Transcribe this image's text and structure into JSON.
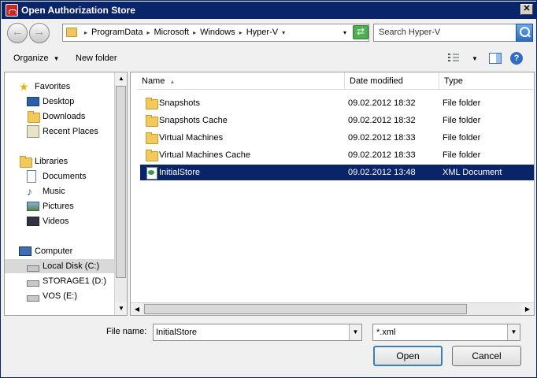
{
  "window": {
    "title": "Open Authorization Store",
    "close_glyph": "✕"
  },
  "nav": {
    "back_glyph": "←",
    "forward_glyph": "→"
  },
  "address": {
    "crumbs": [
      "ProgramData",
      "Microsoft",
      "Windows",
      "Hyper-V"
    ],
    "separator_glyph": "▸",
    "dropdown_glyph": "▾",
    "refresh_glyph": "⇄"
  },
  "search": {
    "placeholder": "Search Hyper-V"
  },
  "toolbar": {
    "organize_label": "Organize",
    "organize_caret": "▼",
    "new_folder_label": "New folder",
    "views_caret": "▼",
    "help_glyph": "?"
  },
  "sidebar": {
    "groups": [
      {
        "label": "Favorites",
        "icon": "star-icon",
        "items": [
          {
            "label": "Desktop",
            "icon": "desktop-icon"
          },
          {
            "label": "Downloads",
            "icon": "downloads-icon"
          },
          {
            "label": "Recent Places",
            "icon": "recent-places-icon"
          }
        ]
      },
      {
        "label": "Libraries",
        "icon": "libraries-icon",
        "items": [
          {
            "label": "Documents",
            "icon": "documents-icon"
          },
          {
            "label": "Music",
            "icon": "music-icon"
          },
          {
            "label": "Pictures",
            "icon": "pictures-icon"
          },
          {
            "label": "Videos",
            "icon": "videos-icon"
          }
        ]
      },
      {
        "label": "Computer",
        "icon": "computer-icon",
        "items": [
          {
            "label": "Local Disk (C:)",
            "icon": "local-disk-icon",
            "selected": true
          },
          {
            "label": "STORAGE1 (D:)",
            "icon": "drive-icon"
          },
          {
            "label": "VOS (E:)",
            "icon": "drive-icon"
          }
        ]
      }
    ]
  },
  "file_list": {
    "columns": [
      "Name",
      "Date modified",
      "Type"
    ],
    "sort_glyph": "▲",
    "rows": [
      {
        "name": "Snapshots",
        "date": "09.02.2012 18:32",
        "type": "File folder",
        "icon": "folder-icon"
      },
      {
        "name": "Snapshots Cache",
        "date": "09.02.2012 18:32",
        "type": "File folder",
        "icon": "folder-icon"
      },
      {
        "name": "Virtual Machines",
        "date": "09.02.2012 18:33",
        "type": "File folder",
        "icon": "folder-icon"
      },
      {
        "name": "Virtual Machines Cache",
        "date": "09.02.2012 18:33",
        "type": "File folder",
        "icon": "folder-icon"
      },
      {
        "name": "InitialStore",
        "date": "09.02.2012 13:48",
        "type": "XML Document",
        "icon": "xml-document-icon",
        "selected": true
      }
    ]
  },
  "scroll": {
    "up": "▲",
    "down": "▼",
    "left": "◀",
    "right": "▶"
  },
  "bottom": {
    "file_name_label": "File name:",
    "file_name_value": "InitialStore",
    "file_type_value": "*.xml",
    "combo_glyph": "▼",
    "open_label": "Open",
    "cancel_label": "Cancel"
  },
  "colors": {
    "title_bar": "#0a246a",
    "selection": "#0a246a",
    "window_bg": "#f0f0f0"
  }
}
